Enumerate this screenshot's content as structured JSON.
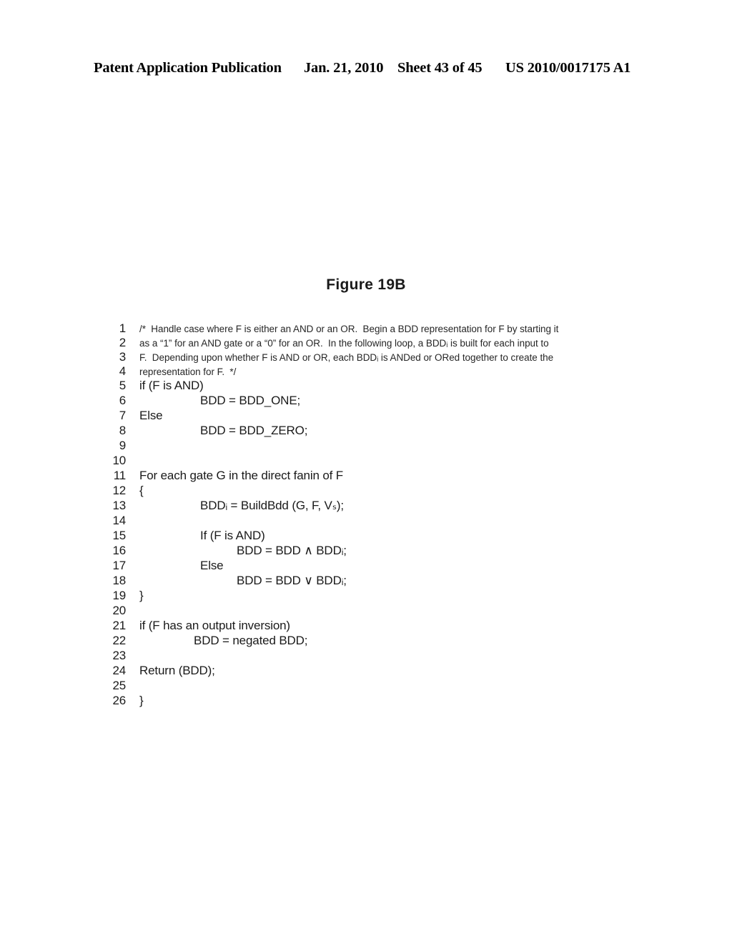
{
  "header": {
    "publication": "Patent Application Publication",
    "date": "Jan. 21, 2010",
    "sheet": "Sheet 43 of 45",
    "patent_number": "US 2010/0017175 A1"
  },
  "figure": {
    "caption": "Figure 19B"
  },
  "code": {
    "lines": [
      {
        "n": "1",
        "text": "/*  Handle case where F is either an AND or an OR.  Begin a BDD representation for F by starting it"
      },
      {
        "n": "2",
        "text": "as a “1” for an AND gate or a “0” for an OR.  In the following loop, a BDDᵢ is built for each input to"
      },
      {
        "n": "3",
        "text": "F.  Depending upon whether F is AND or OR, each BDDᵢ is ANDed or ORed together to create the"
      },
      {
        "n": "4",
        "text": "representation for F.  */"
      },
      {
        "n": "5",
        "text": "if (F is AND)"
      },
      {
        "n": "6",
        "text": "BDD = BDD_ONE;"
      },
      {
        "n": "7",
        "text": "Else"
      },
      {
        "n": "8",
        "text": "BDD = BDD_ZERO;"
      },
      {
        "n": "9",
        "text": ""
      },
      {
        "n": "10",
        "text": ""
      },
      {
        "n": "11",
        "text": "For each gate G in the direct fanin of F"
      },
      {
        "n": "12",
        "text": "{"
      },
      {
        "n": "13",
        "text": "BDDᵢ = BuildBdd (G, F, Vₛ);"
      },
      {
        "n": "14",
        "text": ""
      },
      {
        "n": "15",
        "text": "If (F is AND)"
      },
      {
        "n": "16",
        "text": "BDD = BDD ∧ BDDᵢ;"
      },
      {
        "n": "17",
        "text": "Else"
      },
      {
        "n": "18",
        "text": "BDD = BDD ∨ BDDᵢ;"
      },
      {
        "n": "19",
        "text": "}"
      },
      {
        "n": "20",
        "text": ""
      },
      {
        "n": "21",
        "text": "if (F has an output inversion)"
      },
      {
        "n": "22",
        "text": "BDD = negated BDD;"
      },
      {
        "n": "23",
        "text": ""
      },
      {
        "n": "24",
        "text": "Return (BDD);"
      },
      {
        "n": "25",
        "text": ""
      },
      {
        "n": "26",
        "text": "}"
      }
    ]
  }
}
